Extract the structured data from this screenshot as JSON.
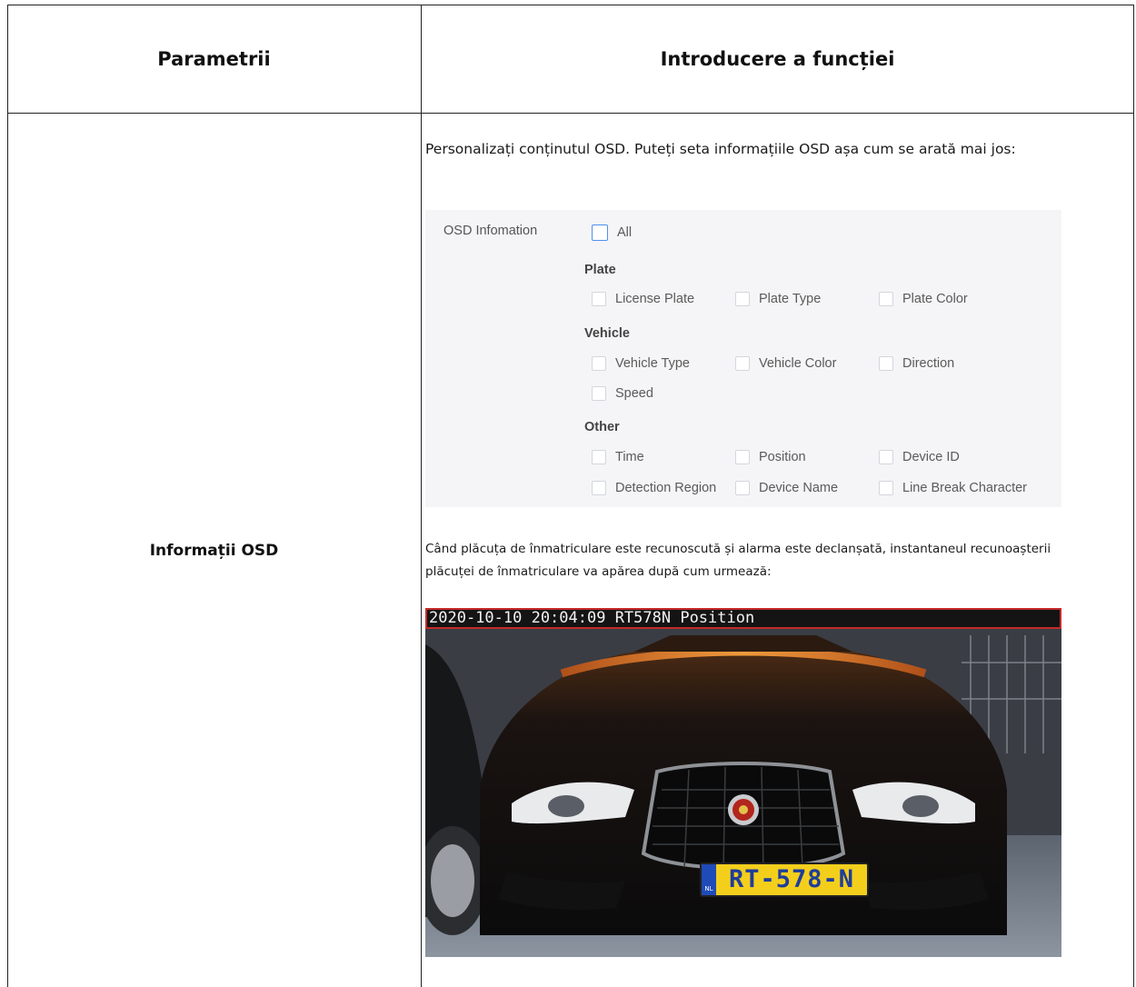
{
  "table": {
    "header_param": "Parametrii",
    "header_function": "Introducere a funcției"
  },
  "row": {
    "param_name": "Informații OSD",
    "intro_text": "Personalizați conținutul OSD. Puteți seta informațiile OSD așa cum se arată mai jos:",
    "note_text": "Când plăcuța de înmatriculare este recunoscută și alarma este declanșată, instantaneul recunoașterii plăcuței de înmatriculare va apărea după cum urmează:"
  },
  "osd": {
    "label": "OSD Infomation",
    "all": "All",
    "groups": {
      "plate": "Plate",
      "vehicle": "Vehicle",
      "other": "Other"
    },
    "plate_items": [
      "License Plate",
      "Plate Type",
      "Plate Color"
    ],
    "vehicle_items": [
      "Vehicle Type",
      "Vehicle Color",
      "Direction",
      "Speed"
    ],
    "other_items": [
      "Time",
      "Position",
      "Device ID",
      "Detection Region",
      "Device Name",
      "Line Break Character"
    ]
  },
  "snapshot": {
    "overlay_text": "2020-10-10 20:04:09 RT578N Position",
    "plate_text": "RT-578-N",
    "plate_country": "NL"
  },
  "colors": {
    "checkbox_accent": "#4e8ff2",
    "overlay_border": "#c52a2a",
    "plate_yellow": "#f3cf1c",
    "plate_blue": "#1f4bb8"
  }
}
